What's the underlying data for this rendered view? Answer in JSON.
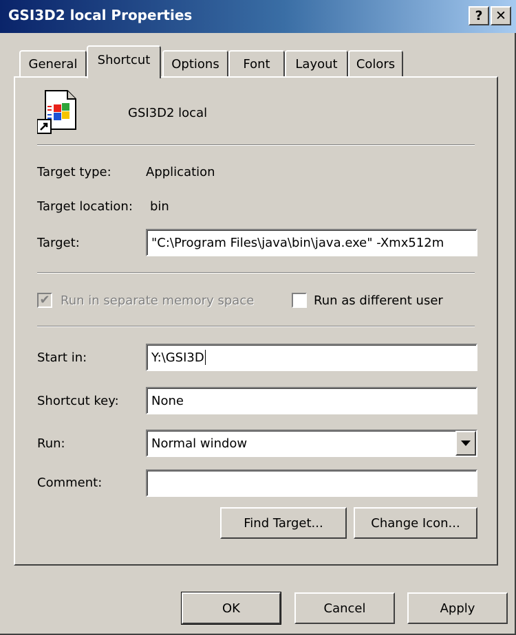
{
  "window": {
    "title": "GSI3D2 local Properties",
    "help_button": "?",
    "close_button": "✕"
  },
  "tabs": [
    {
      "label": "General",
      "active": false
    },
    {
      "label": "Shortcut",
      "active": true
    },
    {
      "label": "Options",
      "active": false
    },
    {
      "label": "Font",
      "active": false
    },
    {
      "label": "Layout",
      "active": false
    },
    {
      "label": "Colors",
      "active": false
    }
  ],
  "shortcut": {
    "name": "GSI3D2 local",
    "icon": "shortcut-application-icon",
    "target_type_label": "Target type:",
    "target_type_value": "Application",
    "target_location_label": "Target location:",
    "target_location_value": "bin",
    "target_label": "Target:",
    "target_value": "\"C:\\Program Files\\java\\bin\\java.exe\" -Xmx512m",
    "run_separate_label": "Run in separate memory space",
    "run_separate_checked": true,
    "run_as_different_label": "Run as different user",
    "run_as_different_checked": false,
    "start_in_label": "Start in:",
    "start_in_value": "Y:\\GSI3D",
    "shortcut_key_label": "Shortcut key:",
    "shortcut_key_value": "None",
    "run_label": "Run:",
    "run_value": "Normal window",
    "comment_label": "Comment:",
    "comment_value": "",
    "find_target_label": "Find Target...",
    "change_icon_label": "Change Icon..."
  },
  "footer": {
    "ok_label": "OK",
    "cancel_label": "Cancel",
    "apply_label": "Apply"
  }
}
